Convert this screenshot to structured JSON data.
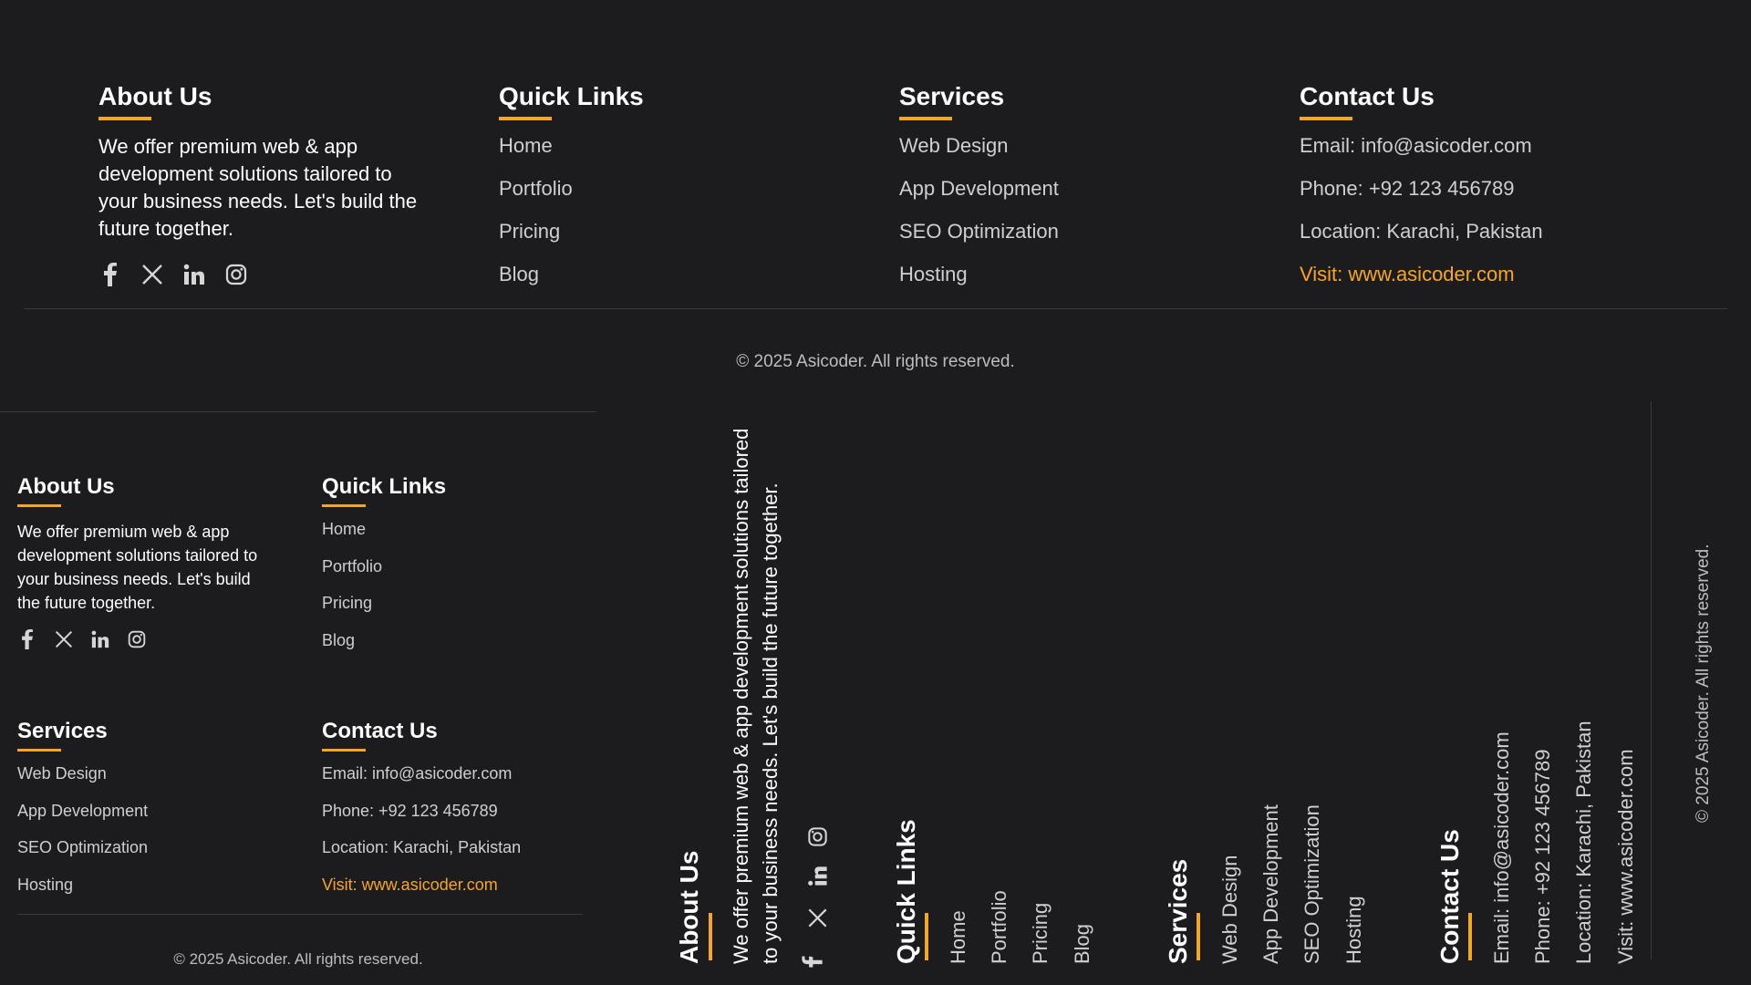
{
  "footer": {
    "about": {
      "title": "About Us",
      "text": "We offer premium web & app development solutions tailored to your business needs. Let's build the future together.",
      "text_line1": "We offer premium web & app development solutions tailored",
      "text_line2": "to your business needs. Let's build the future together."
    },
    "quick_links": {
      "title": "Quick Links",
      "items": [
        "Home",
        "Portfolio",
        "Pricing",
        "Blog"
      ]
    },
    "services": {
      "title": "Services",
      "items": [
        "Web Design",
        "App Development",
        "SEO Optimization",
        "Hosting"
      ]
    },
    "contact": {
      "title": "Contact Us",
      "email": "Email: info@asicoder.com",
      "phone": "Phone: +92 123 456789",
      "location": "Location: Karachi, Pakistan",
      "visit": "Visit: www.asicoder.com"
    },
    "social": [
      "facebook-icon",
      "x-icon",
      "linkedin-icon",
      "instagram-icon"
    ],
    "copyright": "© 2025 Asicoder. All rights reserved."
  },
  "colors": {
    "background": "#1c1c1e",
    "accent": "#f5a623",
    "heading": "#ffffff",
    "link": "#cfcfcf",
    "divider": "#3a3a3c"
  }
}
